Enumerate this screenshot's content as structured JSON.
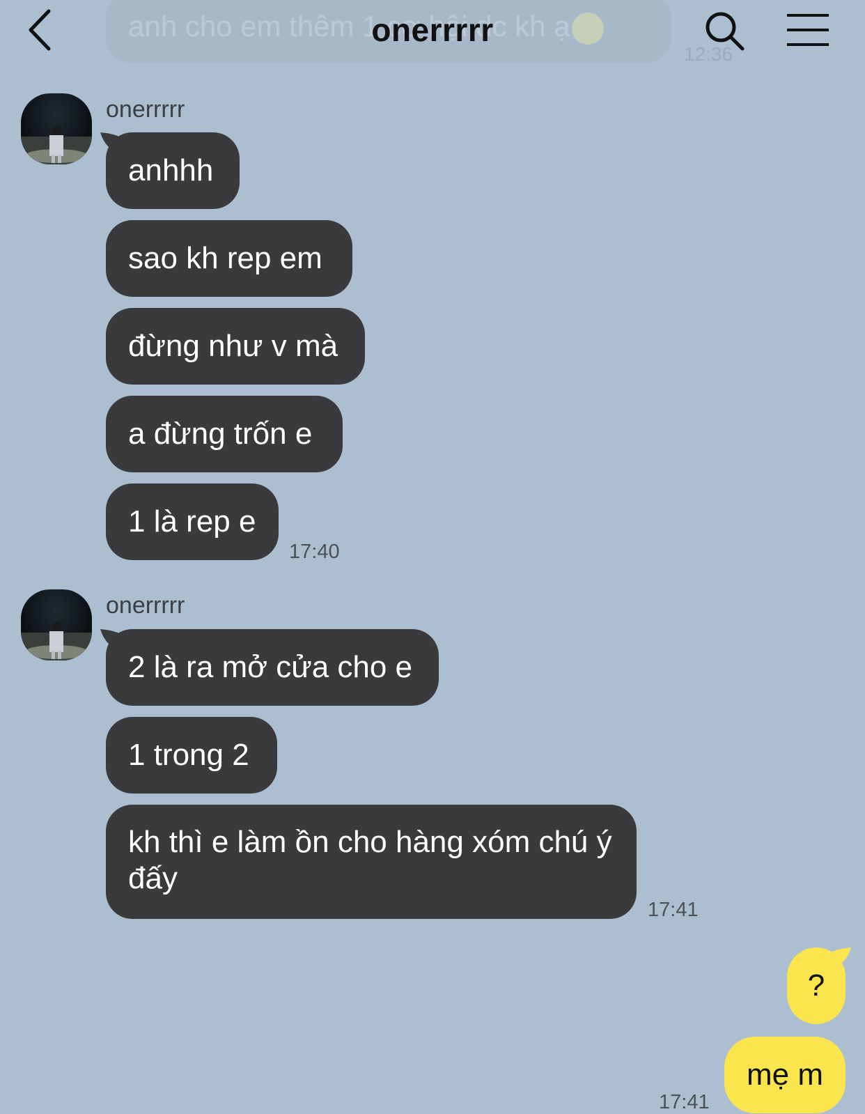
{
  "header": {
    "title": "onerrrrr"
  },
  "previous_message": {
    "text": "anh cho em thêm 1 cơ hội dc kh ạ",
    "time": "12:36"
  },
  "groups": [
    {
      "sender": "onerrrrr",
      "messages": [
        "anhhh",
        "sao kh rep em",
        "đừng như v mà",
        "a đừng trốn e",
        "1 là rep e"
      ],
      "time": "17:40"
    },
    {
      "sender": "onerrrrr",
      "messages": [
        "2 là ra mở cửa cho e",
        "1 trong 2",
        "kh thì e làm ồn cho hàng xóm chú ý đấy"
      ],
      "time": "17:41"
    }
  ],
  "my_messages": {
    "messages": [
      "?",
      "mẹ m"
    ],
    "time": "17:41"
  },
  "colors": {
    "background": "#abbfd0",
    "their_bubble": "#3a3a3d",
    "my_bubble": "#fae54e"
  }
}
